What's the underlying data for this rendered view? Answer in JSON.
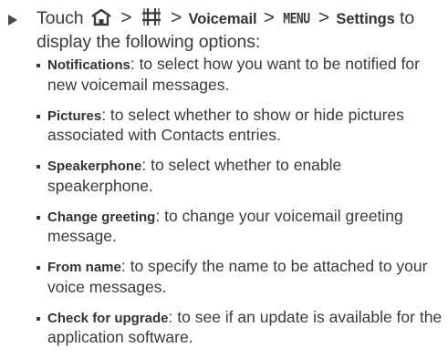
{
  "step": {
    "touch": "Touch",
    "sep": ">",
    "voicemail": "Voicemail",
    "menu_key": "MENU",
    "settings": "Settings",
    "to_display": "to display the following options:"
  },
  "icons": {
    "home": "home-icon",
    "grid": "apps-grid-icon"
  },
  "options": [
    {
      "term": "Notifications",
      "desc": ": to select how you want to be notified for new voicemail messages."
    },
    {
      "term": "Pictures",
      "desc": ": to select whether to show or hide pictures associated with Contacts entries."
    },
    {
      "term": "Speakerphone",
      "desc": ": to select whether to enable speakerphone."
    },
    {
      "term": "Change greeting",
      "desc": ": to change your voicemail greeting message."
    },
    {
      "term": "From name",
      "desc": ": to specify the name to be attached to your voice messages."
    },
    {
      "term": "Check for upgrade",
      "desc": ": to see if an update is available for the application software."
    }
  ],
  "colors": {
    "text": "#3a3a3a"
  }
}
